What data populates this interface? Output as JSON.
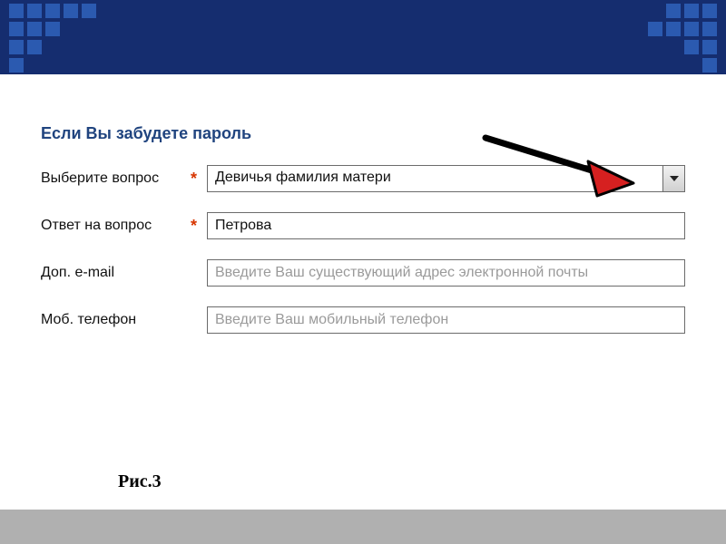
{
  "section_title": "Если Вы забудете пароль",
  "labels": {
    "question": "Выберите вопрос",
    "answer": "Ответ на вопрос",
    "alt_email": "Доп. e-mail",
    "mobile": "Моб. телефон"
  },
  "required_mark": "*",
  "fields": {
    "question_value": "Девичья фамилия матери",
    "answer_value": "Петрова",
    "alt_email_placeholder": "Введите Ваш существующий адрес электронной почты",
    "mobile_placeholder": "Введите Ваш мобильный телефон"
  },
  "caption": "Рис.3",
  "colors": {
    "banner_bg": "#152d6f",
    "square": "#2b5ab0",
    "title": "#20447f",
    "required": "#d73500"
  }
}
